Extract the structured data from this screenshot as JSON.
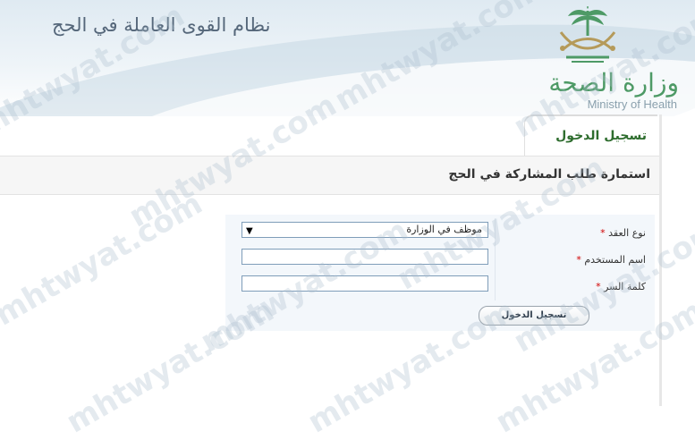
{
  "header": {
    "system_title": "نظام القوى العاملة في الحج",
    "logo_arabic": "وزارة الصحة",
    "logo_english": "Ministry of Health"
  },
  "login": {
    "tab_title": "تسجيل الدخول",
    "form_title": "استمارة طلب المشاركة في الحج"
  },
  "form": {
    "contract_type_label": "نوع العقد",
    "contract_type_value": "موظف في الوزارة",
    "username_label": "اسم المستخدم",
    "password_label": "كلمة السر",
    "required_mark": "*",
    "submit_label": "تسجيل الدخول"
  },
  "watermark": {
    "text": "mhtwyat.com"
  },
  "colors": {
    "accent_green": "#2e6d2e",
    "logo_green": "#4e9a66",
    "required_red": "#d00000"
  }
}
